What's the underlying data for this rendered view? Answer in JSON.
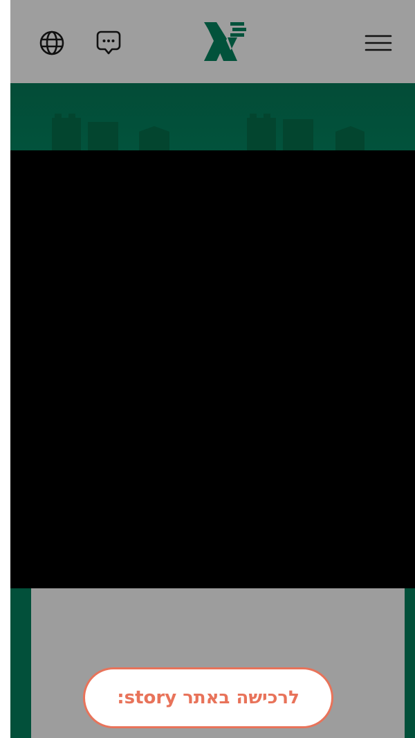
{
  "header": {
    "globe_icon": "globe-icon",
    "chat_icon": "chat-bubble-icon",
    "menu_icon": "hamburger-menu-icon",
    "logo_icon": "xe-logo-icon"
  },
  "cta": {
    "label": "לרכישה באתר story:"
  },
  "colors": {
    "brand_green": "#02503a",
    "accent": "#e8735a",
    "overlay_gray": "#9c9c9c"
  }
}
